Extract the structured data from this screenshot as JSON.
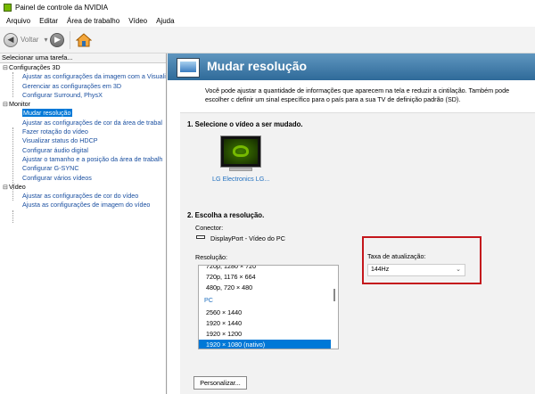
{
  "window": {
    "title": "Painel de controle da NVIDIA"
  },
  "menu": [
    "Arquivo",
    "Editar",
    "Área de trabalho",
    "Vídeo",
    "Ajuda"
  ],
  "toolbar": {
    "back_label": "Voltar"
  },
  "left_pane": {
    "header": "Selecionar uma tarefa...",
    "categories": [
      {
        "label": "Configurações 3D",
        "items": [
          "Ajustar as configurações da imagem com a Visuali",
          "Gerenciar as configurações em 3D",
          "Configurar Surround, PhysX"
        ]
      },
      {
        "label": "Monitor",
        "items": [
          "Mudar resolução",
          "Ajustar as configurações de cor da área de trabal",
          "Fazer rotação do vídeo",
          "Visualizar status do HDCP",
          "Configurar áudio digital",
          "Ajustar o tamanho e a posição da área de trabalh",
          "Configurar G-SYNC",
          "Configurar vários vídeos"
        ]
      },
      {
        "label": "Vídeo",
        "items": [
          "Ajustar as configurações de cor do vídeo",
          "Ajusta as configurações de imagem do vídeo"
        ]
      }
    ],
    "selected_item": "Mudar resolução"
  },
  "main": {
    "title": "Mudar resolução",
    "description": "Você pode ajustar a quantidade de informações que aparecem na tela e reduzir  a cintilação. Também pode escolher c definir um sinal específico para o país para a sua TV de definição padrão (SD).",
    "step1_title": "1. Selecione o vídeo a ser mudado.",
    "monitor_label": "LG Electronics LG...",
    "step2_title": "2. Escolha a resolução.",
    "connector_label": "Conector:",
    "connector_value": "DisplayPort - Vídeo do PC",
    "resolution_label": "Resolução:",
    "resolutions": [
      "720p, 1280 × 720",
      "720p, 1176 × 664",
      "480p, 720 × 480",
      "PC",
      "2560 × 1440",
      "1920 × 1440",
      "1920 × 1200",
      "1920 × 1080 (nativo)"
    ],
    "selected_resolution": "1920 × 1080 (nativo)",
    "refresh_label": "Taxa de atualização:",
    "refresh_value": "144Hz",
    "customize_button": "Personalizar..."
  },
  "colors": {
    "accent": "#76b900",
    "selection": "#0078d7",
    "highlight_box": "#c4161c",
    "banner": "#3b76a6"
  }
}
